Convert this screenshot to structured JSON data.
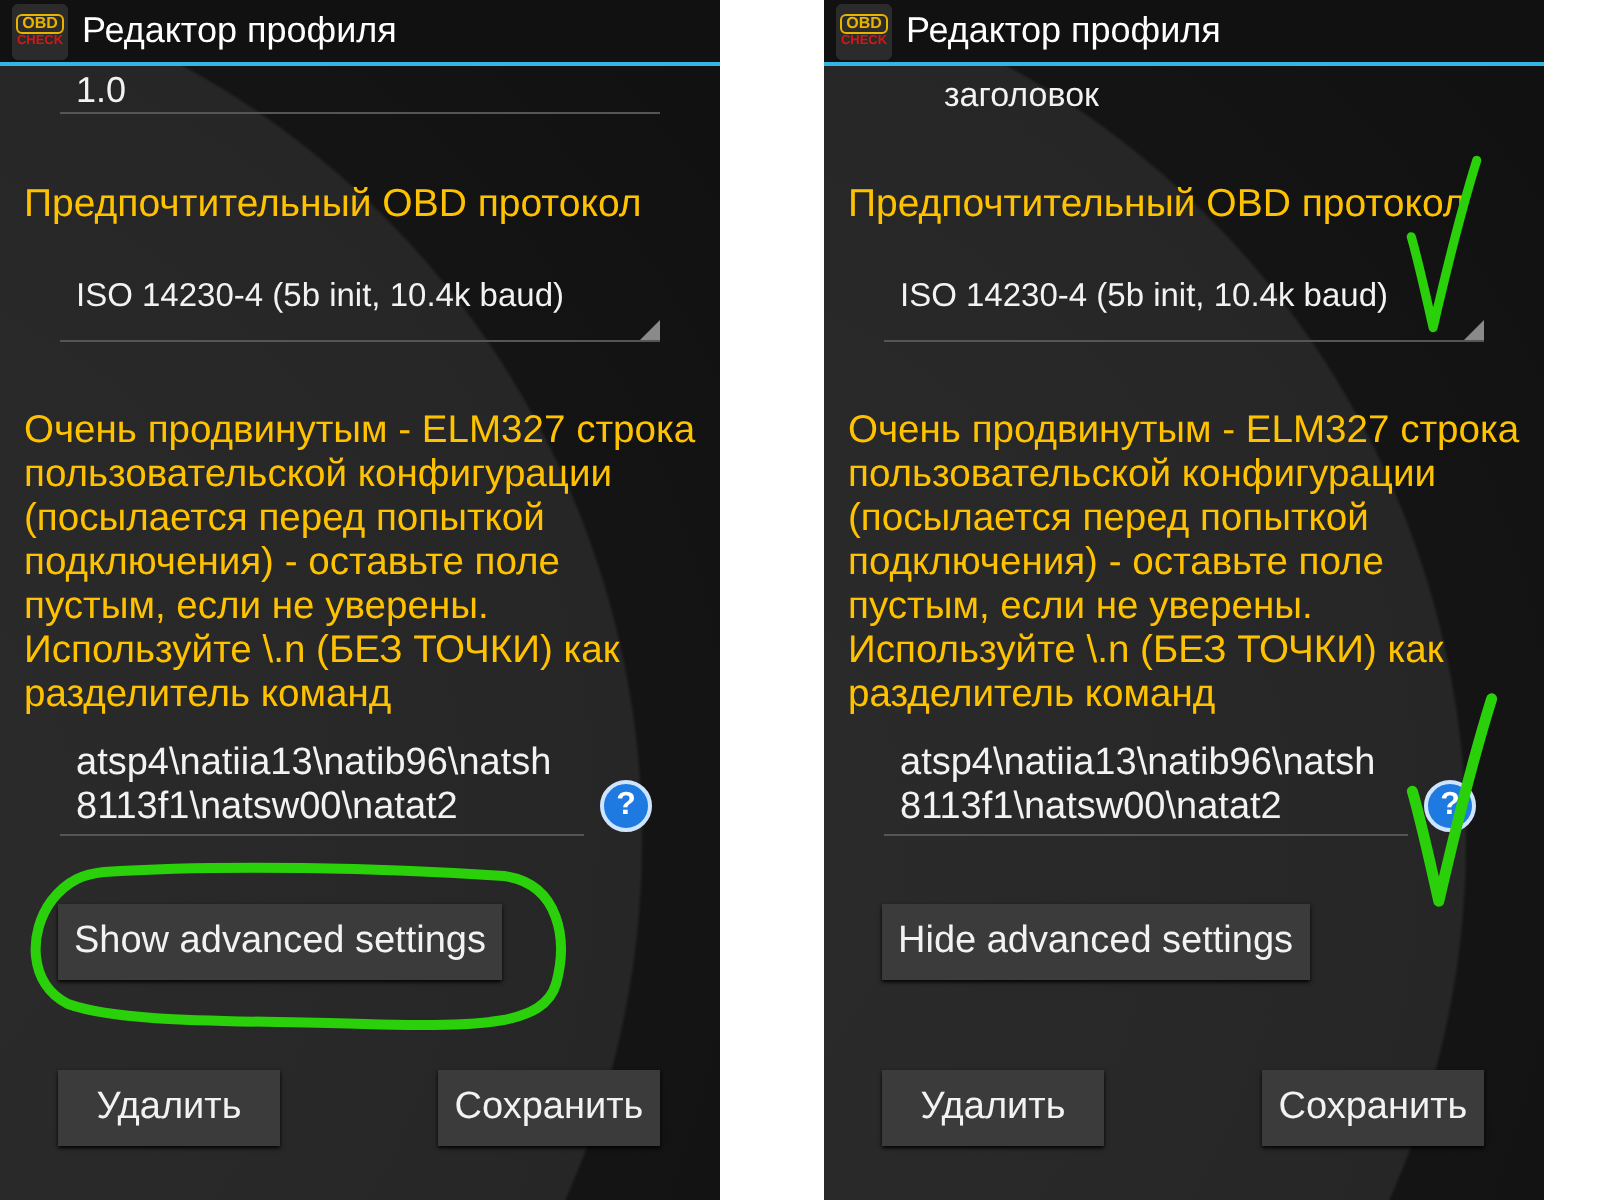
{
  "screens": [
    {
      "app_icon": {
        "top": "OBD",
        "bottom": "CHECK"
      },
      "title": "Редактор профиля",
      "top_item": {
        "kind": "field",
        "value": "1.0"
      },
      "protocol_label": "Предпочтительный OBD протокол",
      "protocol_value": "ISO 14230-4 (5b init, 10.4k baud)",
      "advanced_note": "Очень продвинутым - ELM327 строка пользовательской конфигурации (посылается перед попыткой подключения) - оставьте поле пустым, если не уверены. Используйте \\.n (БЕЗ ТОЧКИ) как разделитель команд",
      "init_string": "atsp4\\natiia13\\natib96\\natsh8113f1\\natsw00\\natat2",
      "help_icon": "?",
      "toggle_button": "Show advanced settings",
      "actions": [
        {
          "label": "Удалить"
        },
        {
          "label": "Сохранить"
        }
      ],
      "toggle_annotation": {
        "kind": "ellipse"
      }
    },
    {
      "app_icon": {
        "top": "OBD",
        "bottom": "CHECK"
      },
      "title": "Редактор профиля",
      "top_item": {
        "kind": "text",
        "value": "заголовок"
      },
      "protocol_label": "Предпочтительный OBD протокол",
      "protocol_value": "ISO 14230-4 (5b init, 10.4k baud)",
      "advanced_note": "Очень продвинутым - ELM327 строка пользовательской конфигурации (посылается перед попыткой подключения) - оставьте поле пустым, если не уверены. Используйте \\.n (БЕЗ ТОЧКИ) как разделитель команд",
      "init_string": "atsp4\\natiia13\\natib96\\natsh8113f1\\natsw00\\natat2",
      "help_icon": "?",
      "toggle_button": "Hide advanced settings",
      "actions": [
        {
          "label": "Удалить"
        },
        {
          "label": "Сохранить"
        }
      ],
      "protocol_annotation": {
        "kind": "check"
      },
      "init_annotation": {
        "kind": "check"
      }
    }
  ]
}
